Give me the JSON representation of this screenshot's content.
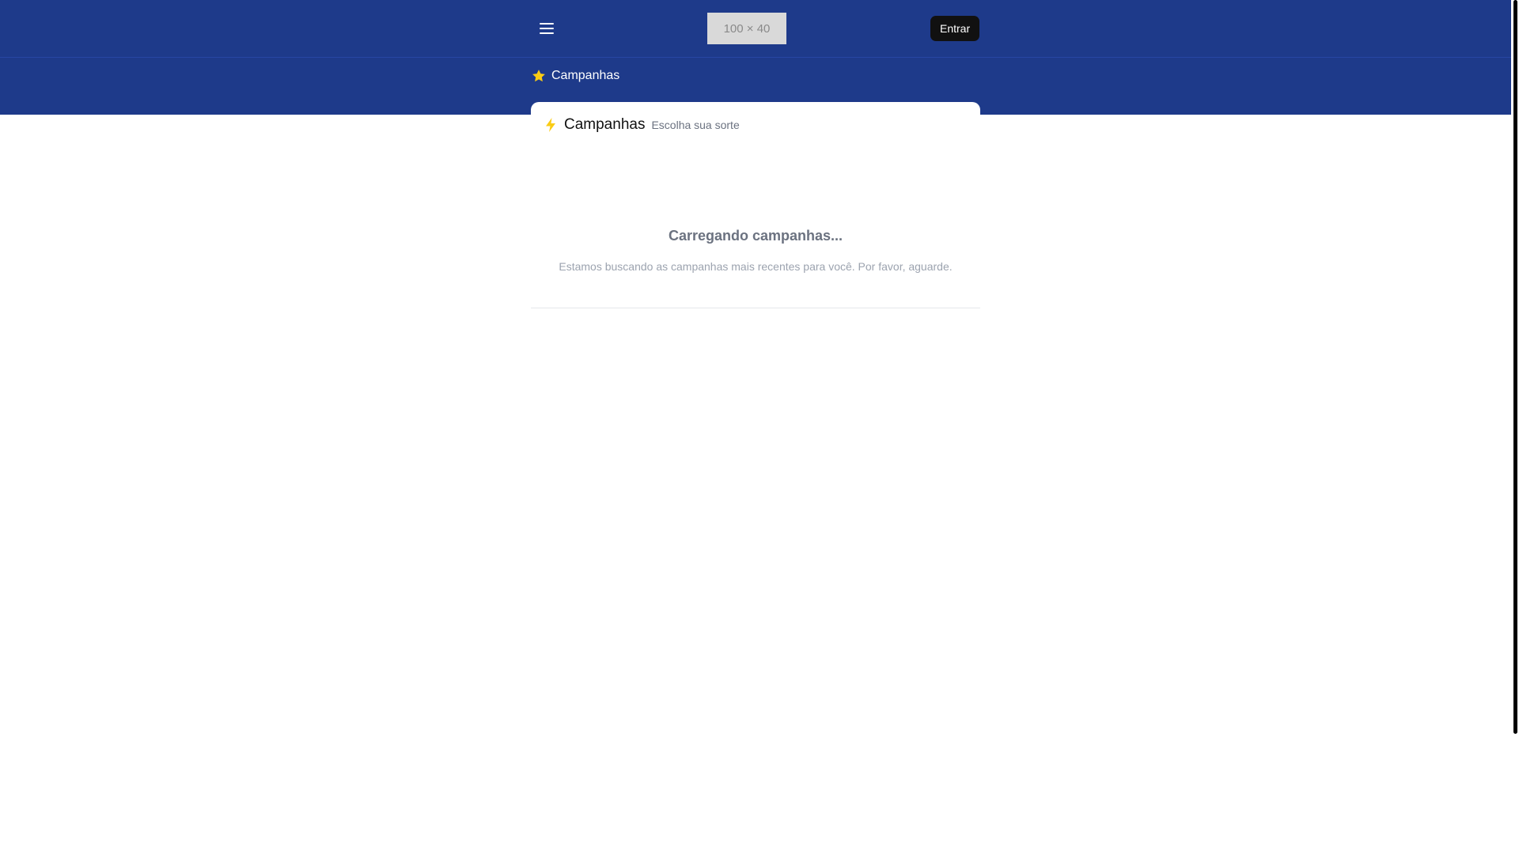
{
  "header": {
    "logo_placeholder": "100 × 40",
    "login_label": "Entrar",
    "menu_icon": "hamburger-menu-icon",
    "background_color": "#1e3a8a"
  },
  "breadcrumb": {
    "icon": "star-icon",
    "label": "Campanhas"
  },
  "campaigns_card": {
    "icon": "lightning-bolt-icon",
    "title": "Campanhas",
    "subtitle": "Escolha sua sorte",
    "loading_title": "Carregando campanhas...",
    "loading_message": "Estamos buscando as campanhas mais recentes para você. Por favor, aguarde."
  },
  "colors": {
    "accent_yellow": "#facc15",
    "primary_blue": "#1e3a8a",
    "button_dark": "#111111"
  }
}
